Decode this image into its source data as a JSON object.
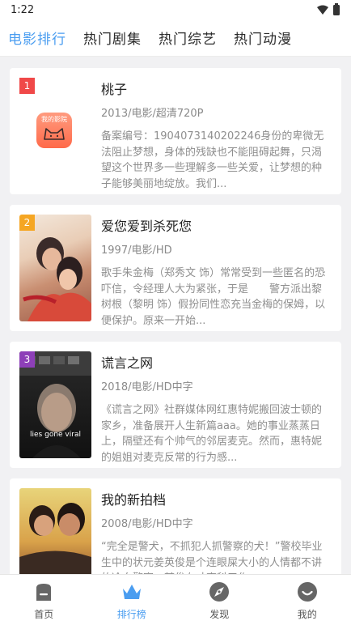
{
  "status": {
    "time": "1:22"
  },
  "tabs": [
    {
      "label": "电影排行"
    },
    {
      "label": "热门剧集"
    },
    {
      "label": "热门综艺"
    },
    {
      "label": "热门动漫"
    }
  ],
  "movies": [
    {
      "rank": "1",
      "rank_color": "#f04848",
      "title": "桃子",
      "meta": "2013/电影/超清720P",
      "desc": "备案编号：1904073140202246身份的卑微无法阻止梦想，身体的残缺也不能阻碍起舞，只渴望这个世界多一些理解多一些关爱，让梦想的种子能够美丽地绽放。我们...",
      "poster_text": "我的影院"
    },
    {
      "rank": "2",
      "rank_color": "#f5a623",
      "title": "爱您爱到杀死您",
      "meta": "1997/电影/HD",
      "desc": "歌手朱金梅（郑秀文 饰）常常受到一些匿名的恐吓信，令经理人大为紧张，于是　　警方派出黎树根（黎明 饰）假扮同性恋充当金梅的保姆，以便保护。原来一开始..."
    },
    {
      "rank": "3",
      "rank_color": "#8d3fb8",
      "title": "谎言之网",
      "meta": "2018/电影/HD中字",
      "desc": "《谎言之网》社群媒体网红惠特妮搬回波士顿的家乡，准备展开人生新篇aaa。她的事业蒸蒸日上，隔壁还有个帅气的邻居麦克。然而，惠特妮的姐姐对麦克反常的行为感...",
      "poster_text": "lies gone viral"
    },
    {
      "rank": "",
      "rank_color": "",
      "title": "我的新拍档",
      "meta": "2008/电影/HD中字",
      "desc": "“完全是警犬，不抓犯人抓警察的犬！”警校毕业生中的状元姜英俊是个连眼屎大小的人情都不讲的冷血警察，某俊在寸事科于作..."
    }
  ],
  "nav": [
    {
      "label": "首页"
    },
    {
      "label": "排行榜"
    },
    {
      "label": "发现"
    },
    {
      "label": "我的"
    }
  ],
  "colors": {
    "accent": "#4a9df0",
    "nav_icon": "#666666",
    "background": "#f1f1f3"
  }
}
